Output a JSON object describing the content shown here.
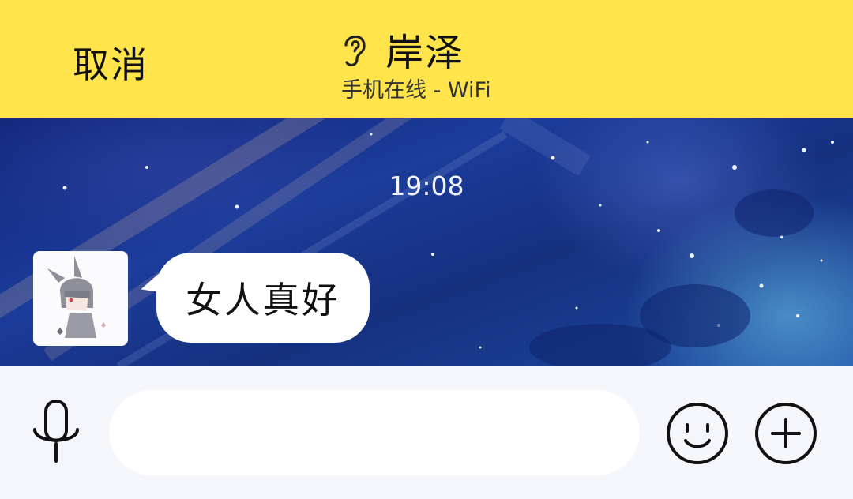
{
  "header": {
    "cancel_label": "取消",
    "contact_name": "岸泽",
    "status": "手机在线 - WiFi",
    "ear_icon": "ear-icon"
  },
  "chat": {
    "timestamp": "19:08",
    "messages": [
      {
        "sender": "incoming",
        "text": "女人真好",
        "avatar_icon": "anime-girl-avatar"
      }
    ]
  },
  "input_bar": {
    "value": "",
    "placeholder": "",
    "icons": [
      "microphone-icon",
      "emoji-icon",
      "plus-icon"
    ]
  },
  "colors": {
    "header_bg": "#ffe44c",
    "input_bar_bg": "#f5f6fb",
    "bubble_bg": "#ffffff"
  }
}
